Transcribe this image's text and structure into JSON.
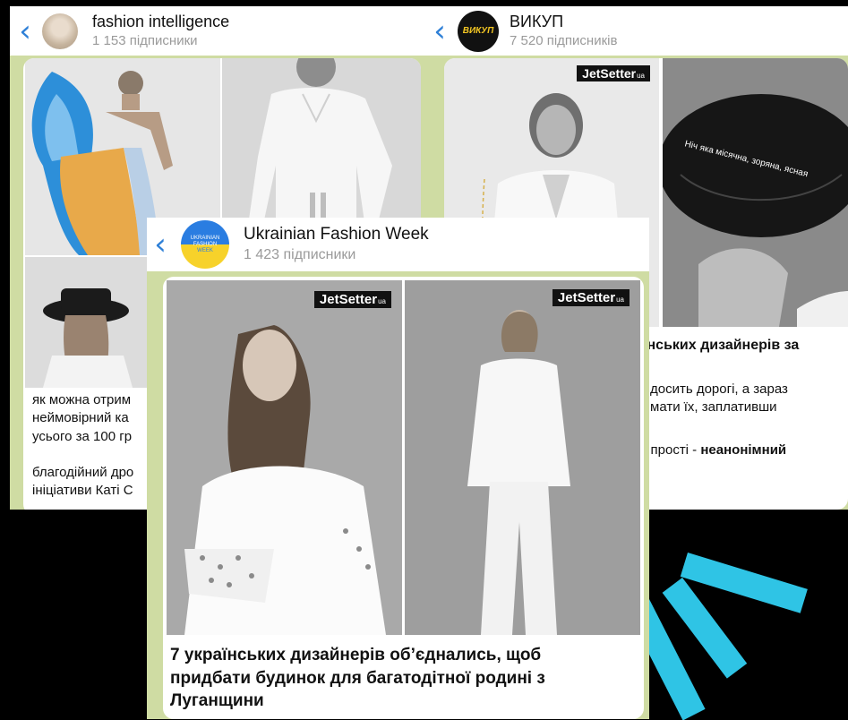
{
  "cards": {
    "fashion_intelligence": {
      "title": "fashion intelligence",
      "subscribers": "1 153 підписники",
      "text_lines": [
        "як можна отрим",
        "неймовірний ка",
        "усього за 100 гр",
        "",
        "благодійний дро",
        "ініціативи Каті С"
      ]
    },
    "vykup": {
      "title": "ВИКУП",
      "avatar_text": "ВИКУП",
      "subscribers": "7 520 підписників",
      "jetsetter": "JetSetter",
      "jetsetter_suffix": "ua",
      "hat_text": "Ніч яка місячна, зоряна, ясная",
      "text_line1": "їнських дизайнерів за",
      "text_line2": "досить дорогі, а зараз",
      "text_line3": "мати їх, заплативши",
      "text_line4_prefix": "е прості - ",
      "text_line4_bold": "неанонімний"
    },
    "ufw": {
      "title": "Ukrainian Fashion Week",
      "subscribers": "1 423 підписники",
      "avatar_lines": [
        "UKRAINIAN",
        "FASHION",
        "WEEK"
      ],
      "jetsetter_left": "JetSetter",
      "jetsetter_right": "JetSetter",
      "jetsetter_suffix": "ua",
      "message": "7 українських дизайнерів об’єднались, щоб придбати будинок для багатодітної родині з Луганщини"
    }
  },
  "colors": {
    "accent_blue": "#2f80d7",
    "chat_background": "#cfdca3",
    "decor_stripes": "#2fc4e5",
    "ufw_blue": "#2a7de1",
    "ufw_yellow": "#f7d22a"
  },
  "icons": [
    "back-chevron-icon",
    "decorative-stripes"
  ]
}
